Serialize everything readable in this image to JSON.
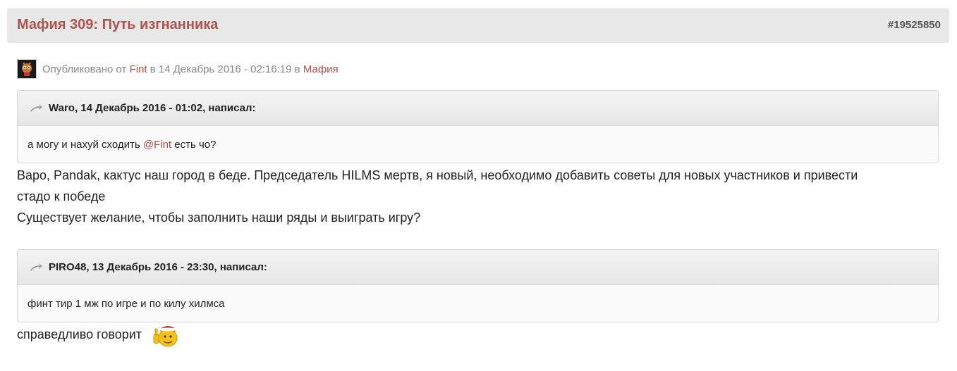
{
  "post": {
    "title": "Мафия 309: Путь изгнанника",
    "id": "#19525850"
  },
  "meta": {
    "published_prefix": "Опубликовано от",
    "author": "Fint",
    "date_text": "в 14 Декабрь 2016 - 02:16:19 в",
    "category": "Мафия"
  },
  "quotes": [
    {
      "header": "Waro, 14 Декабрь 2016 - 01:02, написал:",
      "body_before": "а могу и нахуй сходить ",
      "mention": "@Fint",
      "body_after": " есть чо?"
    },
    {
      "header": "PIRO48, 13 Декабрь 2016 - 23:30, написал:",
      "body": "финт тир 1 мж по игре и по килу хилмса"
    }
  ],
  "body": {
    "line1": "Варо, Pandak, кактус наш город в беде. Председатель HILMS мертв, я новый, необходимо добавить советы для новых участников и привести",
    "line2": "стадо к победе",
    "line3": "Существует желание, чтобы заполнить наши ряды и выиграть игру?",
    "last_line": "справедливо говорит"
  },
  "colors": {
    "accent": "#b0524e",
    "header_bg": "#e8e8e8",
    "meta_text": "#888888"
  },
  "icons": {
    "avatar": "avatar-icon",
    "quote": "quote-icon",
    "smiley": "smiley-icon"
  }
}
